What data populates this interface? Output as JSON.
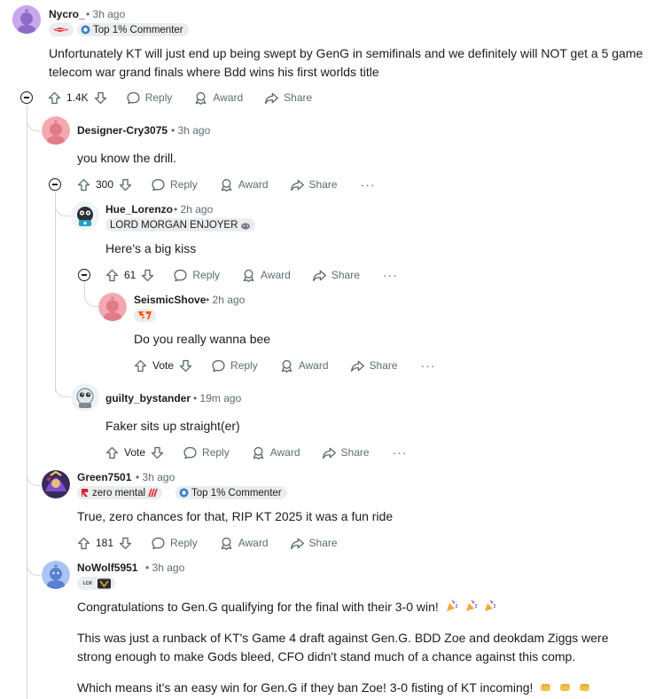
{
  "comments": [
    {
      "username": "Nycro_",
      "time": "3h ago",
      "badge": "Top 1% Commenter",
      "text": "Unfortunately KT will just end up being swept by GenG in semifinals and we definitely will NOT get a 5 game telecom war grand finals where Bdd wins his first worlds title",
      "votes": "1.4K"
    },
    {
      "username": "Designer-Cry3075",
      "time": "3h ago",
      "text": "you know the drill.",
      "votes": "300"
    },
    {
      "username": "Hue_Lorenzo",
      "time": "2h ago",
      "flair": "LORD MORGAN ENJOYER",
      "text": "Here's a big kiss",
      "votes": "61"
    },
    {
      "username": "SeismicShove",
      "time": "2h ago",
      "text": "Do you really wanna bee",
      "votes": "Vote"
    },
    {
      "username": "guilty_bystander",
      "time": "19m ago",
      "text": "Faker sits up straight(er)",
      "votes": "Vote"
    },
    {
      "username": "Green7501",
      "time": "3h ago",
      "flair": "zero mental",
      "badge": "Top 1% Commenter",
      "text": "True, zero chances for that, RIP KT 2025 it was a fun ride",
      "votes": "181"
    },
    {
      "username": "NoWolf5951",
      "time": "3h ago",
      "flair_logo": "LCK",
      "paragraphs": [
        "Congratulations to Gen.G qualifying for the final with their 3-0 win!",
        "This was just a runback of KT's Game 4 draft against Gen.G. BDD Zoe and deokdam Ziggs were strong enough to make Gods bleed, CFO didn't stand much of a chance against this comp.",
        "Which means it's an easy win for Gen.G if they ban Zoe! 3-0 fisting of KT incoming!"
      ]
    }
  ],
  "labels": {
    "reply": "Reply",
    "award": "Award",
    "share": "Share",
    "more": "···",
    "separator": "•"
  },
  "colors": {
    "meta": "#5c6c74",
    "thread_line": "#d4d9dc",
    "flair_bg": "#eaedef",
    "fnatic_orange": "#ff5900",
    "zero_mental_red": "#e0202a"
  }
}
